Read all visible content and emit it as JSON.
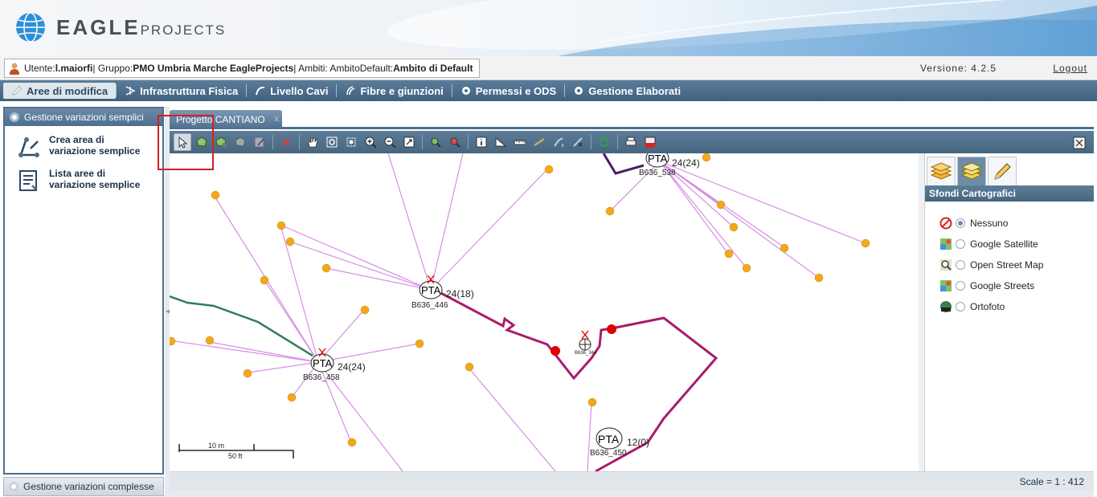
{
  "header": {
    "logo_main": "EAGLE",
    "logo_sub": "PROJECTS"
  },
  "userbar": {
    "user_label": "Utente: ",
    "user_value": "l.maiorfi",
    "group_label": " | Gruppo: ",
    "group_value": "PMO Umbria Marche EagleProjects",
    "scope_label": " | Ambiti: AmbitoDefault: ",
    "scope_value": "Ambito di Default",
    "version": "Versione: 4.2.5",
    "logout": "Logout"
  },
  "menu": {
    "items": [
      {
        "label": "Aree di modifica",
        "active": true
      },
      {
        "label": "Infrastruttura Fisica"
      },
      {
        "label": "Livello Cavi"
      },
      {
        "label": "Fibre e giunzioni"
      },
      {
        "label": "Permessi e ODS"
      },
      {
        "label": "Gestione Elaborati"
      }
    ]
  },
  "left_panel": {
    "header": "Gestione variazioni semplici",
    "items": [
      {
        "label": "Crea area di variazione semplice"
      },
      {
        "label": "Lista aree di variazione semplice"
      }
    ],
    "footer": "Gestione variazioni complesse"
  },
  "tabs": {
    "active": "Progetto CANTIANO",
    "close": "x"
  },
  "map": {
    "nodes": [
      {
        "name": "B636_446",
        "text": "PTA",
        "info": "24(18)"
      },
      {
        "name": "B636_458",
        "text": "PTA",
        "info": "24(24)"
      },
      {
        "name": "B636_538",
        "text": "PTA",
        "info": "24(24)"
      },
      {
        "name": "B636_450",
        "text": "PTA",
        "info": "12(0)"
      },
      {
        "name": "B636_344"
      }
    ],
    "scalebar": {
      "top": "10 m",
      "bottom": "50 ft"
    },
    "colors": {
      "cable": "#d78de6",
      "duct": "#a81c6c",
      "green_line": "#2e7d5b",
      "node_dot": "#f2a81a",
      "red_dot": "#e00000"
    }
  },
  "right_panel": {
    "title": "Sfondi Cartografici",
    "options": [
      {
        "label": "Nessuno",
        "selected": true,
        "icon": "no-entry-icon"
      },
      {
        "label": "Google Satellite",
        "icon": "google-maps-icon"
      },
      {
        "label": "Open Street Map",
        "icon": "magnifier-map-icon"
      },
      {
        "label": "Google Streets",
        "icon": "google-maps-icon"
      },
      {
        "label": "Ortofoto",
        "icon": "wms-globe-icon"
      }
    ]
  },
  "status": {
    "scale": "Scale = 1 : 412"
  }
}
